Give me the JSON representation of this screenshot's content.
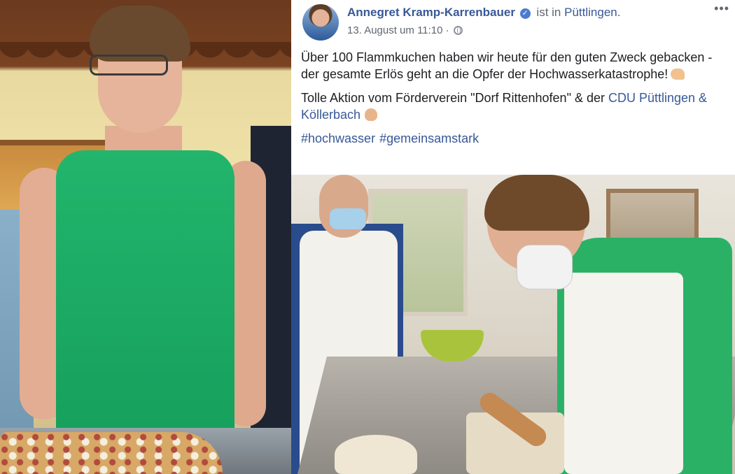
{
  "post": {
    "author": "Annegret Kramp-Karrenbauer",
    "verified_mark": "✓",
    "is_in": "ist in",
    "location": "Püttlingen.",
    "timestamp": "13. August um 11:10",
    "separator": "·",
    "more": "•••",
    "paragraph1": "Über 100 Flammkuchen haben wir heute für den guten Zweck gebacken - der gesamte Erlös geht an die Opfer der Hochwasserkatastrophe!",
    "paragraph2_prefix": "Tolle Aktion vom Förderverein \"Dorf Rittenhofen\" & der",
    "paragraph2_link": "CDU Püttlingen & Köllerbach",
    "hashtags": [
      "#hochwasser",
      "#gemeinsamstark"
    ]
  },
  "icons": {
    "verified": "verified-badge-icon",
    "privacy": "globe-icon",
    "emoji1": "flexed-biceps-emoji",
    "emoji2": "clapping-hands-emoji"
  },
  "colors": {
    "link": "#385898",
    "text": "#1c1e21",
    "meta": "#606770"
  }
}
